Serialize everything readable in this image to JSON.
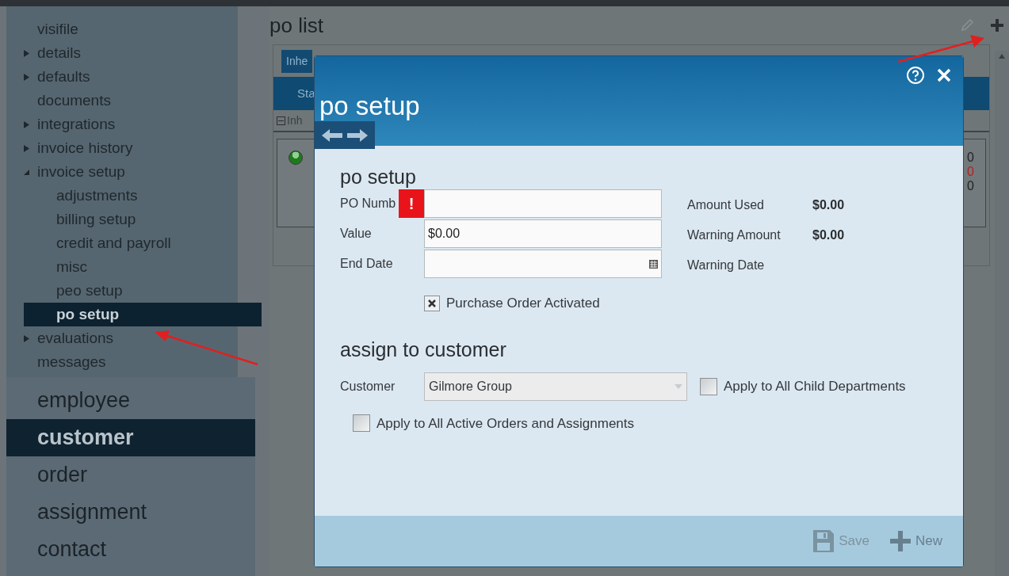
{
  "sidebar": {
    "items": [
      {
        "label": "visifile",
        "selected": false
      },
      {
        "label": "details",
        "expanded": false,
        "selected": false
      },
      {
        "label": "defaults",
        "expanded": false,
        "selected": false
      },
      {
        "label": "documents",
        "selected": false
      },
      {
        "label": "integrations",
        "expanded": false,
        "selected": false
      },
      {
        "label": "invoice history",
        "expanded": false,
        "selected": false
      },
      {
        "label": "invoice setup",
        "expanded": true,
        "selected": false,
        "children": [
          {
            "label": "adjustments",
            "selected": false
          },
          {
            "label": "billing setup",
            "selected": false
          },
          {
            "label": "credit and payroll",
            "selected": false
          },
          {
            "label": "misc",
            "selected": false
          },
          {
            "label": "peo setup",
            "selected": false
          },
          {
            "label": "po setup",
            "selected": true
          }
        ]
      },
      {
        "label": "evaluations",
        "expanded": false,
        "selected": false
      },
      {
        "label": "messages",
        "selected": false
      }
    ]
  },
  "modules": [
    {
      "label": "employee",
      "selected": false
    },
    {
      "label": "customer",
      "selected": true
    },
    {
      "label": "order",
      "selected": false
    },
    {
      "label": "assignment",
      "selected": false
    },
    {
      "label": "contact",
      "selected": false
    }
  ],
  "main": {
    "title": "po list",
    "filter_button": "Inhe",
    "column_1": "Sta",
    "group_row": "Inh",
    "record": {
      "column_values": [
        {
          "text": "0",
          "color": "#222222"
        },
        {
          "text": "0",
          "color": "#b22222"
        },
        {
          "text": "0",
          "color": "#222222"
        }
      ]
    }
  },
  "dialog": {
    "title": "po setup",
    "section_1": "po setup",
    "fields": [
      {
        "label": "PO Numb",
        "kind": "text",
        "error_mark": "!"
      },
      {
        "label": "Value",
        "value": "$0.00",
        "kind": "text"
      },
      {
        "label": "End Date",
        "kind": "date"
      }
    ],
    "info": [
      {
        "label": "Amount Used",
        "value": "$0.00"
      },
      {
        "label": "Warning Amount",
        "value": "$0.00"
      },
      {
        "label": "Warning Date"
      }
    ],
    "activated": {
      "label": "Purchase Order Activated",
      "checked": true
    },
    "section_2": "assign to customer",
    "customer": {
      "label": "Customer",
      "value": "Gilmore Group",
      "disabled": true
    },
    "child_departments": {
      "label": "Apply to All Child Departments",
      "checked": false
    },
    "active_orders": {
      "label": "Apply to All Active Orders and Assignments",
      "checked": false
    },
    "footer_buttons": [
      {
        "label": "Save",
        "kind": "save",
        "disabled": true
      },
      {
        "label": "New",
        "kind": "new",
        "disabled": false
      }
    ]
  }
}
